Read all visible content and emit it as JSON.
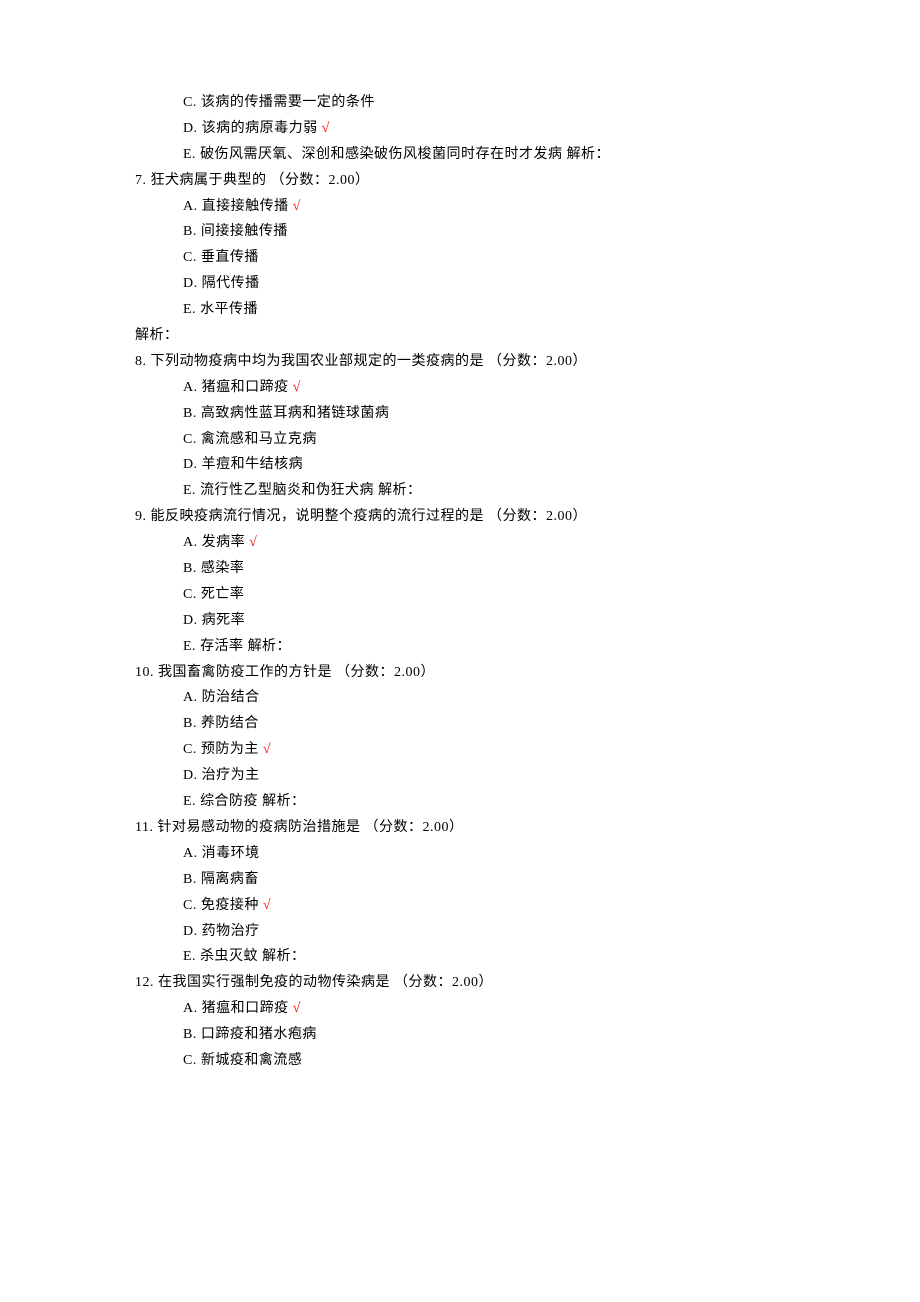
{
  "labels": {
    "score_prefix": "（分数：",
    "score_suffix": "）",
    "score_value": "2.00",
    "analysis": "解析：",
    "marker": "√"
  },
  "lines": [
    {
      "type": "option",
      "letter": "C",
      "text": "该病的传播需要一定的条件",
      "correct": false,
      "trailing_analysis": false
    },
    {
      "type": "option",
      "letter": "D",
      "text": "该病的病原毒力弱",
      "correct": true,
      "trailing_analysis": false
    },
    {
      "type": "option",
      "letter": "E",
      "text": "破伤风需厌氧、深创和感染破伤风梭菌同时存在时才发病",
      "correct": false,
      "trailing_analysis": true
    },
    {
      "type": "question",
      "number": "7",
      "text": "狂犬病属于典型的 "
    },
    {
      "type": "option",
      "letter": "A",
      "text": "直接接触传播",
      "correct": true,
      "trailing_analysis": false
    },
    {
      "type": "option",
      "letter": "B",
      "text": "间接接触传播",
      "correct": false,
      "trailing_analysis": false
    },
    {
      "type": "option",
      "letter": "C",
      "text": "垂直传播",
      "correct": false,
      "trailing_analysis": false
    },
    {
      "type": "option",
      "letter": "D",
      "text": "隔代传播",
      "correct": false,
      "trailing_analysis": false
    },
    {
      "type": "option",
      "letter": "E",
      "text": "水平传播",
      "correct": false,
      "trailing_analysis": false
    },
    {
      "type": "analysis_line"
    },
    {
      "type": "question",
      "number": "8",
      "text": "下列动物疫病中均为我国农业部规定的一类疫病的是 "
    },
    {
      "type": "option",
      "letter": "A",
      "text": "猪瘟和口蹄疫",
      "correct": true,
      "trailing_analysis": false
    },
    {
      "type": "option",
      "letter": "B",
      "text": "高致病性蓝耳病和猪链球菌病",
      "correct": false,
      "trailing_analysis": false
    },
    {
      "type": "option",
      "letter": "C",
      "text": "禽流感和马立克病",
      "correct": false,
      "trailing_analysis": false
    },
    {
      "type": "option",
      "letter": "D",
      "text": "羊痘和牛结核病",
      "correct": false,
      "trailing_analysis": false
    },
    {
      "type": "option",
      "letter": "E",
      "text": "流行性乙型脑炎和伪狂犬病",
      "correct": false,
      "trailing_analysis": true
    },
    {
      "type": "question",
      "number": "9",
      "text": "能反映疫病流行情况，说明整个疫病的流行过程的是 "
    },
    {
      "type": "option",
      "letter": "A",
      "text": "发病率",
      "correct": true,
      "trailing_analysis": false
    },
    {
      "type": "option",
      "letter": "B",
      "text": "感染率",
      "correct": false,
      "trailing_analysis": false
    },
    {
      "type": "option",
      "letter": "C",
      "text": "死亡率",
      "correct": false,
      "trailing_analysis": false
    },
    {
      "type": "option",
      "letter": "D",
      "text": "病死率",
      "correct": false,
      "trailing_analysis": false
    },
    {
      "type": "option",
      "letter": "E",
      "text": "存活率",
      "correct": false,
      "trailing_analysis": true
    },
    {
      "type": "question",
      "number": "10",
      "text": "我国畜禽防疫工作的方针是 "
    },
    {
      "type": "option",
      "letter": "A",
      "text": "防治结合",
      "correct": false,
      "trailing_analysis": false
    },
    {
      "type": "option",
      "letter": "B",
      "text": "养防结合",
      "correct": false,
      "trailing_analysis": false
    },
    {
      "type": "option",
      "letter": "C",
      "text": "预防为主",
      "correct": true,
      "trailing_analysis": false
    },
    {
      "type": "option",
      "letter": "D",
      "text": "治疗为主",
      "correct": false,
      "trailing_analysis": false
    },
    {
      "type": "option",
      "letter": "E",
      "text": "综合防疫",
      "correct": false,
      "trailing_analysis": true
    },
    {
      "type": "question",
      "number": "11",
      "text": "针对易感动物的疫病防治措施是 "
    },
    {
      "type": "option",
      "letter": "A",
      "text": "消毒环境",
      "correct": false,
      "trailing_analysis": false
    },
    {
      "type": "option",
      "letter": "B",
      "text": "隔离病畜",
      "correct": false,
      "trailing_analysis": false
    },
    {
      "type": "option",
      "letter": "C",
      "text": "免疫接种",
      "correct": true,
      "trailing_analysis": false
    },
    {
      "type": "option",
      "letter": "D",
      "text": "药物治疗",
      "correct": false,
      "trailing_analysis": false
    },
    {
      "type": "option",
      "letter": "E",
      "text": "杀虫灭蚊",
      "correct": false,
      "trailing_analysis": true
    },
    {
      "type": "question",
      "number": "12",
      "text": "在我国实行强制免疫的动物传染病是 "
    },
    {
      "type": "option",
      "letter": "A",
      "text": "猪瘟和口蹄疫",
      "correct": true,
      "trailing_analysis": false
    },
    {
      "type": "option",
      "letter": "B",
      "text": "口蹄疫和猪水疱病",
      "correct": false,
      "trailing_analysis": false
    },
    {
      "type": "option",
      "letter": "C",
      "text": "新城疫和禽流感",
      "correct": false,
      "trailing_analysis": false
    }
  ]
}
